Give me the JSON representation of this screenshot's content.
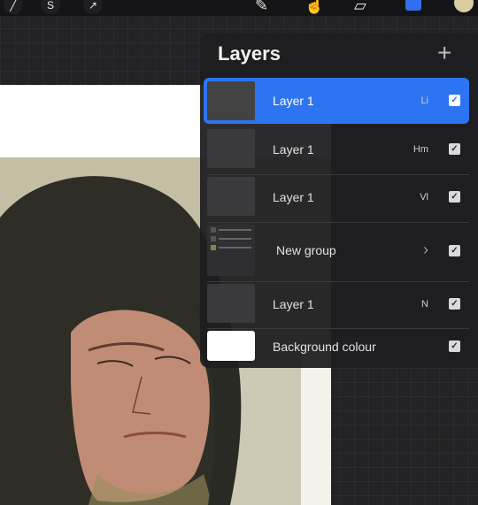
{
  "panel": {
    "title": "Layers",
    "add_label": "+"
  },
  "layers": [
    {
      "name": "Layer 1",
      "blend": "Li",
      "visible": true,
      "selected": true
    },
    {
      "name": "Layer 1",
      "blend": "Hm",
      "visible": true,
      "selected": false
    },
    {
      "name": "Layer 1",
      "blend": "Vl",
      "visible": true,
      "selected": false
    },
    {
      "name": "New group",
      "blend": "",
      "visible": true,
      "selected": false,
      "is_group": true
    },
    {
      "name": "Layer 1",
      "blend": "N",
      "visible": true,
      "selected": false
    },
    {
      "name": "Background colour",
      "blend": "",
      "visible": true,
      "selected": false
    }
  ],
  "toolbar": {
    "icons": [
      "modify-icon",
      "selection-icon",
      "transform-icon",
      "brush-icon",
      "smudge-icon",
      "eraser-icon",
      "layers-icon",
      "color-icon"
    ]
  },
  "colors": {
    "selected": "#2d74f2",
    "panel_bg": "#1e1e20",
    "current_color": "#d9cba2"
  }
}
